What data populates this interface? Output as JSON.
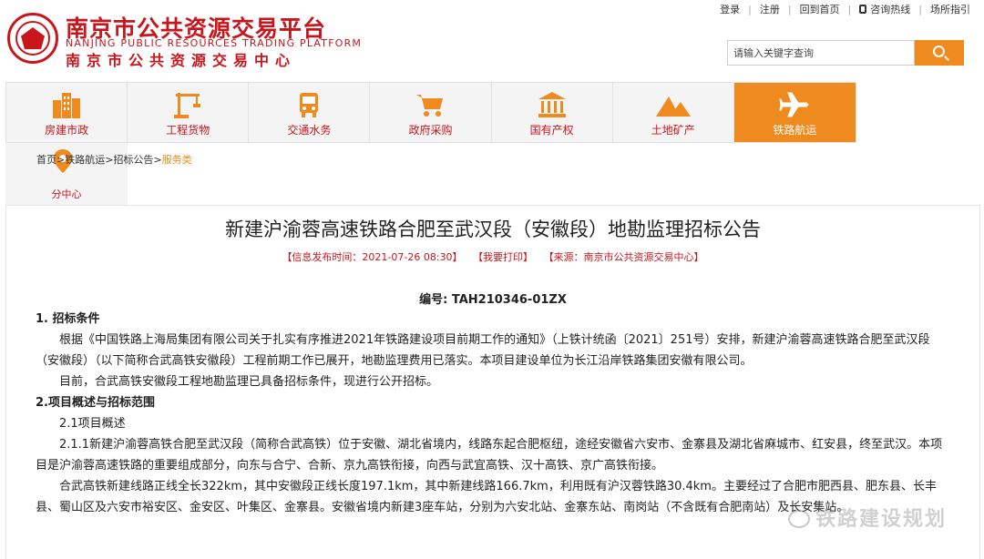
{
  "header": {
    "logo_cn": "南京市公共资源交易平台",
    "logo_en": "NANJING PUBLIC RESOURCES TRADING PLATFORM",
    "logo_center": "南京市公共资源交易中心",
    "links": [
      "登录",
      "注册",
      "回到首页",
      "咨询热线",
      "场所指引"
    ],
    "search_placeholder": "请输入关键字查询",
    "accent_color": "#ef8a1e",
    "brand_color": "#c8161d"
  },
  "nav": {
    "items": [
      "房建市政",
      "工程货物",
      "交通水务",
      "政府采购",
      "国有产权",
      "土地矿产",
      "铁路航运"
    ],
    "active": "铁路航运"
  },
  "subnav": {
    "label": "分中心"
  },
  "breadcrumb": {
    "items": [
      "首页",
      "铁路航运",
      "招标公告"
    ],
    "sep": ">",
    "current": "服务类"
  },
  "article": {
    "title": "新建沪渝蓉高速铁路合肥至武汉段（安徽段）地勘监理招标公告",
    "publish_time": "【信息发布时间：2021-07-26 08:30】",
    "print": "【我要打印】",
    "source": "【来源：南京市公共资源交易中心】",
    "code": "编号: TAH210346-01ZX",
    "sections": [
      {
        "type": "h",
        "text": "1. 招标条件"
      },
      {
        "type": "p",
        "text": "根据《中国铁路上海局集团有限公司关于扎实有序推进2021年铁路建设项目前期工作的通知》（上铁计统函〔2021〕251号）安排，新建沪渝蓉高速铁路合肥至武汉段（安徽段）（以下简称合武高铁安徽段）工程前期工作已展开，地勘监理费用已落实。本项目建设单位为长江沿岸铁路集团安徽有限公司。"
      },
      {
        "type": "p",
        "text": "目前，合武高铁安徽段工程地勘监理已具备招标条件，现进行公开招标。"
      },
      {
        "type": "h",
        "text": "2.项目概述与招标范围"
      },
      {
        "type": "p",
        "text": "2.1项目概述"
      },
      {
        "type": "p",
        "text": "2.1.1新建沪渝蓉高铁合肥至武汉段（简称合武高铁）位于安徽、湖北省境内，线路东起合肥枢纽，途经安徽省六安市、金寨县及湖北省麻城市、红安县，终至武汉。本项目是沪渝蓉高速铁路的重要组成部分，向东与合宁、合新、京九高铁衔接，向西与武宜高铁、汉十高铁、京广高铁衔接。"
      },
      {
        "type": "p",
        "text": "合武高铁新建线路正线全长322km，其中安徽段正线长度197.1km，其中新建线路166.7km，利用既有沪汉蓉铁路30.4km。主要经过了合肥市肥西县、肥东县、长丰县、蜀山区及六安市裕安区、金安区、叶集区、金寨县。安徽省境内新建3座车站，分别为六安北站、金寨东站、南岗站（不含既有合肥南站）及长安集站。"
      }
    ]
  },
  "watermark": "铁路建设规划"
}
